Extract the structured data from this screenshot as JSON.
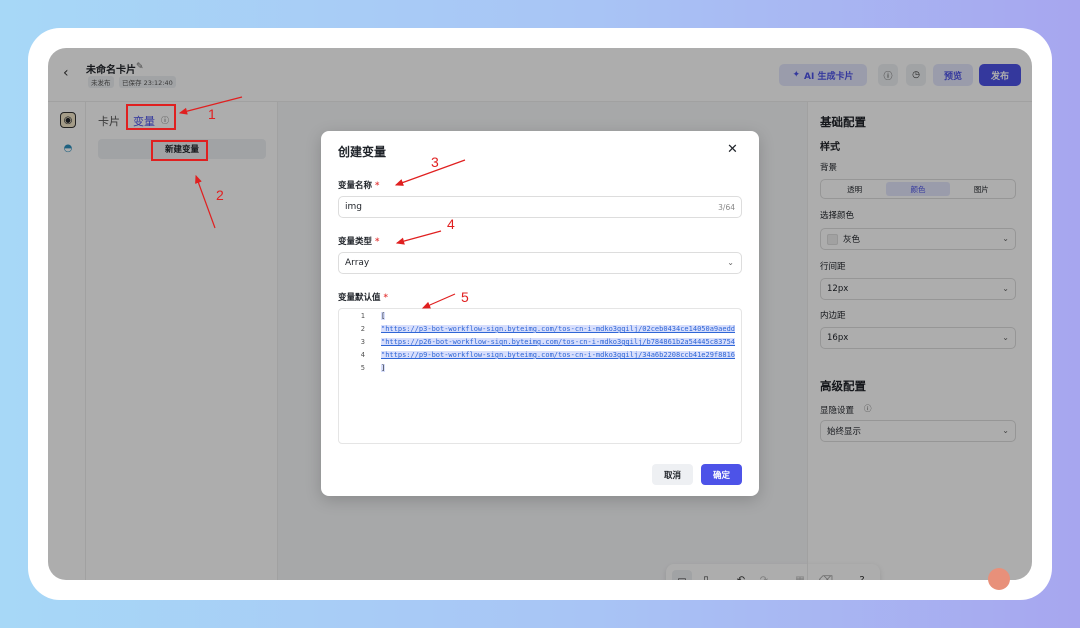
{
  "topbar": {
    "back_icon": "‹",
    "title": "未命名卡片",
    "tags": [
      "未发布",
      "已保存 23:12:40"
    ],
    "ai_button": "AI 生成卡片",
    "preview": "预览",
    "publish": "发布"
  },
  "left_panel": {
    "tabs": [
      "卡片",
      "变量"
    ],
    "new_variable": "新建变量"
  },
  "right_panel": {
    "basic_title": "基础配置",
    "style_title": "样式",
    "background_label": "背景",
    "background_options": [
      "透明",
      "颜色",
      "图片"
    ],
    "background_selected": "颜色",
    "color_label": "选择颜色",
    "color_value": "灰色",
    "line_spacing_label": "行间距",
    "line_spacing_value": "12px",
    "padding_label": "内边距",
    "padding_value": "16px",
    "advanced_title": "高级配置",
    "visibility_label": "显隐设置",
    "visibility_value": "始终显示"
  },
  "dialog": {
    "title": "创建变量",
    "name_label": "变量名称",
    "name_value": "img",
    "name_count": "3/64",
    "type_label": "变量类型",
    "type_value": "Array",
    "default_label": "变量默认值",
    "code_lines": [
      {
        "n": "1",
        "text": "["
      },
      {
        "n": "2",
        "text": "\"https://p3-bot-workflow-sign.byteimg.com/tos-cn-i-mdko3gqilj/02ceb0434ce14050a9aedd"
      },
      {
        "n": "3",
        "text": "\"https://p26-bot-workflow-sign.byteimg.com/tos-cn-i-mdko3gqilj/b784861b2a54445c83754"
      },
      {
        "n": "4",
        "text": "\"https://p9-bot-workflow-sign.byteimg.com/tos-cn-i-mdko3gqilj/34a6b2208ccb41e29f8816"
      },
      {
        "n": "5",
        "text": "]"
      }
    ],
    "cancel": "取消",
    "confirm": "确定"
  },
  "annotations": [
    "1",
    "2",
    "3",
    "4",
    "5"
  ],
  "colors": {
    "accent": "#4d53e8",
    "annotation": "#e02020",
    "required": "#e54545"
  }
}
